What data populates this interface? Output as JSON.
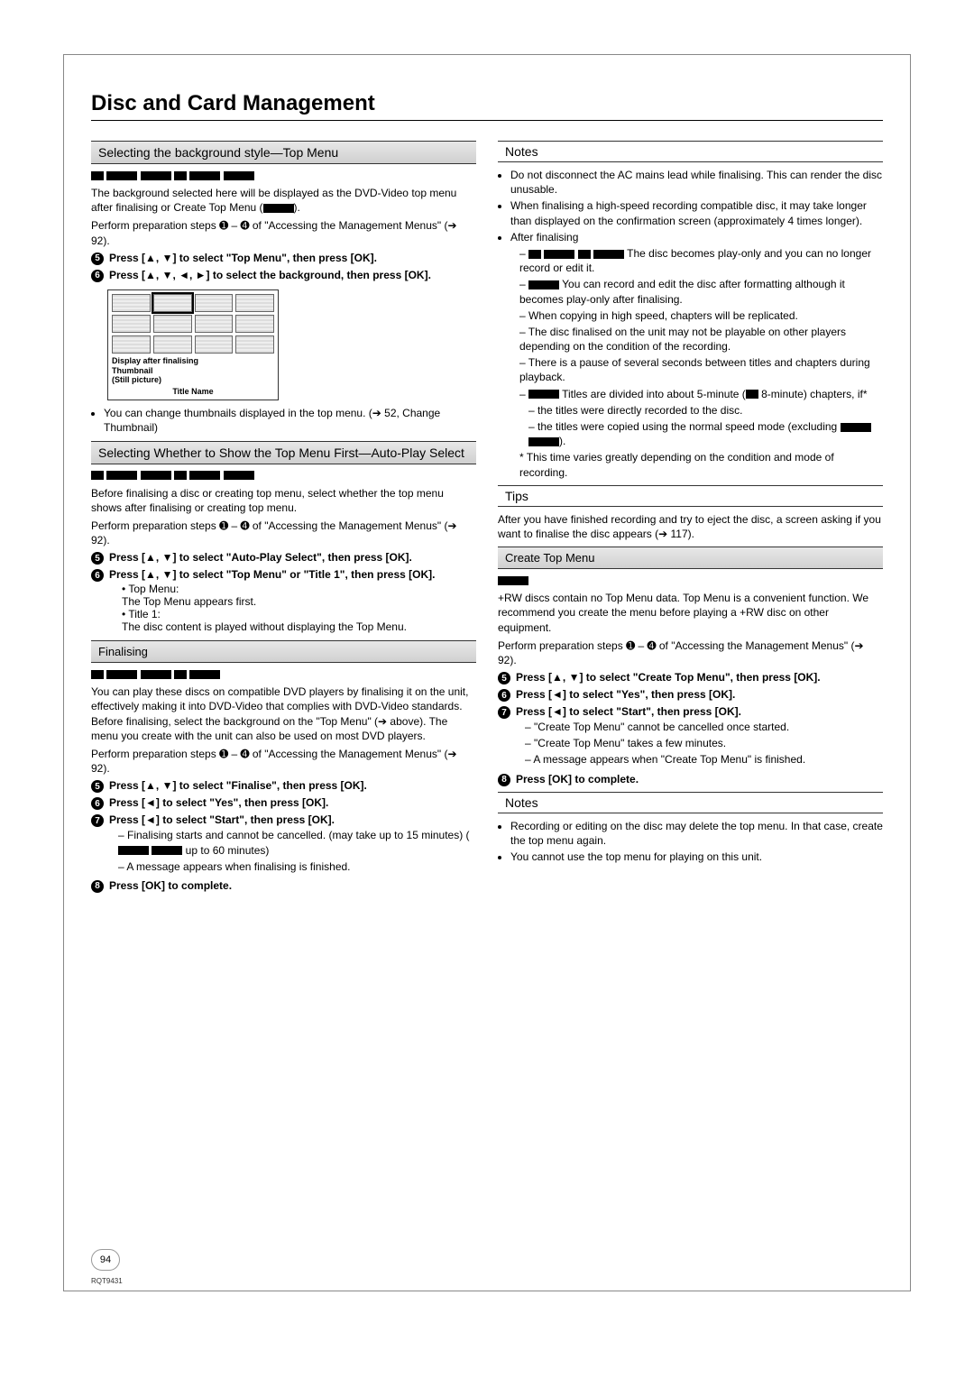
{
  "page_title": "Disc and Card Management",
  "page_number": "94",
  "doc_code": "RQT9431",
  "left": {
    "sec1_title": "Selecting the background style—Top Menu",
    "sec1_p1a": "The background selected here will be displayed as the DVD-Video top menu after finalising or Create Top Menu (",
    "sec1_p1b": ").",
    "sec1_prep": "Perform preparation steps ➊ – ➍ of \"Accessing the Management Menus\" (➔ 92).",
    "sec1_step5": "Press [▲, ▼] to select \"Top Menu\", then press [OK].",
    "sec1_step6": "Press [▲, ▼, ◄, ►] to select the background, then press [OK].",
    "thumb_lbl1": "Display after finalising",
    "thumb_lbl2": "Thumbnail",
    "thumb_lbl3": "(Still picture)",
    "thumb_footer": "Title Name",
    "sec1_bullet": "You can change thumbnails displayed in the top menu. (➔ 52, Change Thumbnail)",
    "sec2_title": "Selecting Whether to Show the Top Menu First—Auto-Play Select",
    "sec2_p1": "Before finalising a disc or creating top menu, select whether the top menu shows after finalising or creating top menu.",
    "sec2_prep": "Perform preparation steps ➊ – ➍ of \"Accessing the Management Menus\" (➔ 92).",
    "sec2_step5": "Press [▲, ▼] to select \"Auto-Play Select\", then press [OK].",
    "sec2_step6": "Press [▲, ▼] to select \"Top Menu\" or \"Title 1\", then press [OK].",
    "sec2_opt1_lbl": "Top Menu:",
    "sec2_opt1_txt": "The Top Menu appears first.",
    "sec2_opt2_lbl": "Title 1:",
    "sec2_opt2_txt": "The disc content is played without displaying the Top Menu.",
    "sec3_title": "Finalising",
    "sec3_p1": "You can play these discs on compatible DVD players by finalising it on the unit, effectively making it into DVD-Video that complies with DVD-Video standards. Before finalising, select the background on the \"Top Menu\" (➔ above). The menu you create with the unit can also be used on most DVD players.",
    "sec3_prep": "Perform preparation steps ➊ – ➍ of \"Accessing the Management Menus\" (➔ 92).",
    "sec3_step5": "Press [▲, ▼] to select \"Finalise\", then press [OK].",
    "sec3_step6": "Press [◄] to select \"Yes\", then press [OK].",
    "sec3_step7": "Press [◄] to select \"Start\", then press [OK].",
    "sec3_d1a": "Finalising starts and cannot be cancelled. (may take up to 15 minutes) (",
    "sec3_d1b": " up to 60 minutes)",
    "sec3_d2": "A message appears when finalising is finished.",
    "sec3_step8": "Press [OK] to complete."
  },
  "right": {
    "notes_title": "Notes",
    "n1": "Do not disconnect the AC mains lead while finalising. This can render the disc unusable.",
    "n2": "When finalising a high-speed recording compatible disc, it may take longer than displayed on the confirmation screen (approximately 4 times longer).",
    "n3": "After finalising",
    "n3a_a": " The disc becomes play-only and you can no longer record or edit it.",
    "n3b_a": " You can record and edit the disc after formatting although it becomes play-only after finalising.",
    "n3c": "When copying in high speed, chapters will be replicated.",
    "n3d": "The disc finalised on the unit may not be playable on other players depending on the condition of the recording.",
    "n3e": "There is a pause of several seconds between titles and chapters during playback.",
    "n3f_a": " Titles are divided into about 5-minute (",
    "n3f_b": " 8-minute) chapters, if*",
    "n3f_i": "the titles were directly recorded to the disc.",
    "n3f_ii_a": "the titles were copied using the normal speed mode (excluding ",
    "n3f_ii_b": ").",
    "n3f_note": "* This time varies greatly depending on the condition and mode of recording.",
    "tips_title": "Tips",
    "tips_p": "After you have finished recording and try to eject the disc, a screen asking if you want to finalise the disc appears (➔ 117).",
    "ctm_title": "Create Top Menu",
    "ctm_p1": "+RW discs contain no Top Menu data. Top Menu is a convenient function. We recommend you create the menu before playing a +RW disc on other equipment.",
    "ctm_prep": "Perform preparation steps ➊ – ➍ of \"Accessing the Management Menus\" (➔ 92).",
    "ctm_step5": "Press [▲, ▼] to select  \"Create Top Menu\", then press [OK].",
    "ctm_step6": "Press [◄] to select \"Yes\", then press [OK].",
    "ctm_step7": "Press [◄] to select \"Start\", then press [OK].",
    "ctm_d1": "\"Create Top Menu\" cannot be cancelled once started.",
    "ctm_d2": "\"Create Top Menu\" takes a few minutes.",
    "ctm_d3": "A message appears when \"Create Top Menu\" is finished.",
    "ctm_step8": "Press [OK] to complete.",
    "notes2_title": "Notes",
    "notes2_b1": "Recording or editing on the disc may delete the top menu. In that case, create the top menu again.",
    "notes2_b2": "You cannot use the top menu for playing on this unit."
  }
}
